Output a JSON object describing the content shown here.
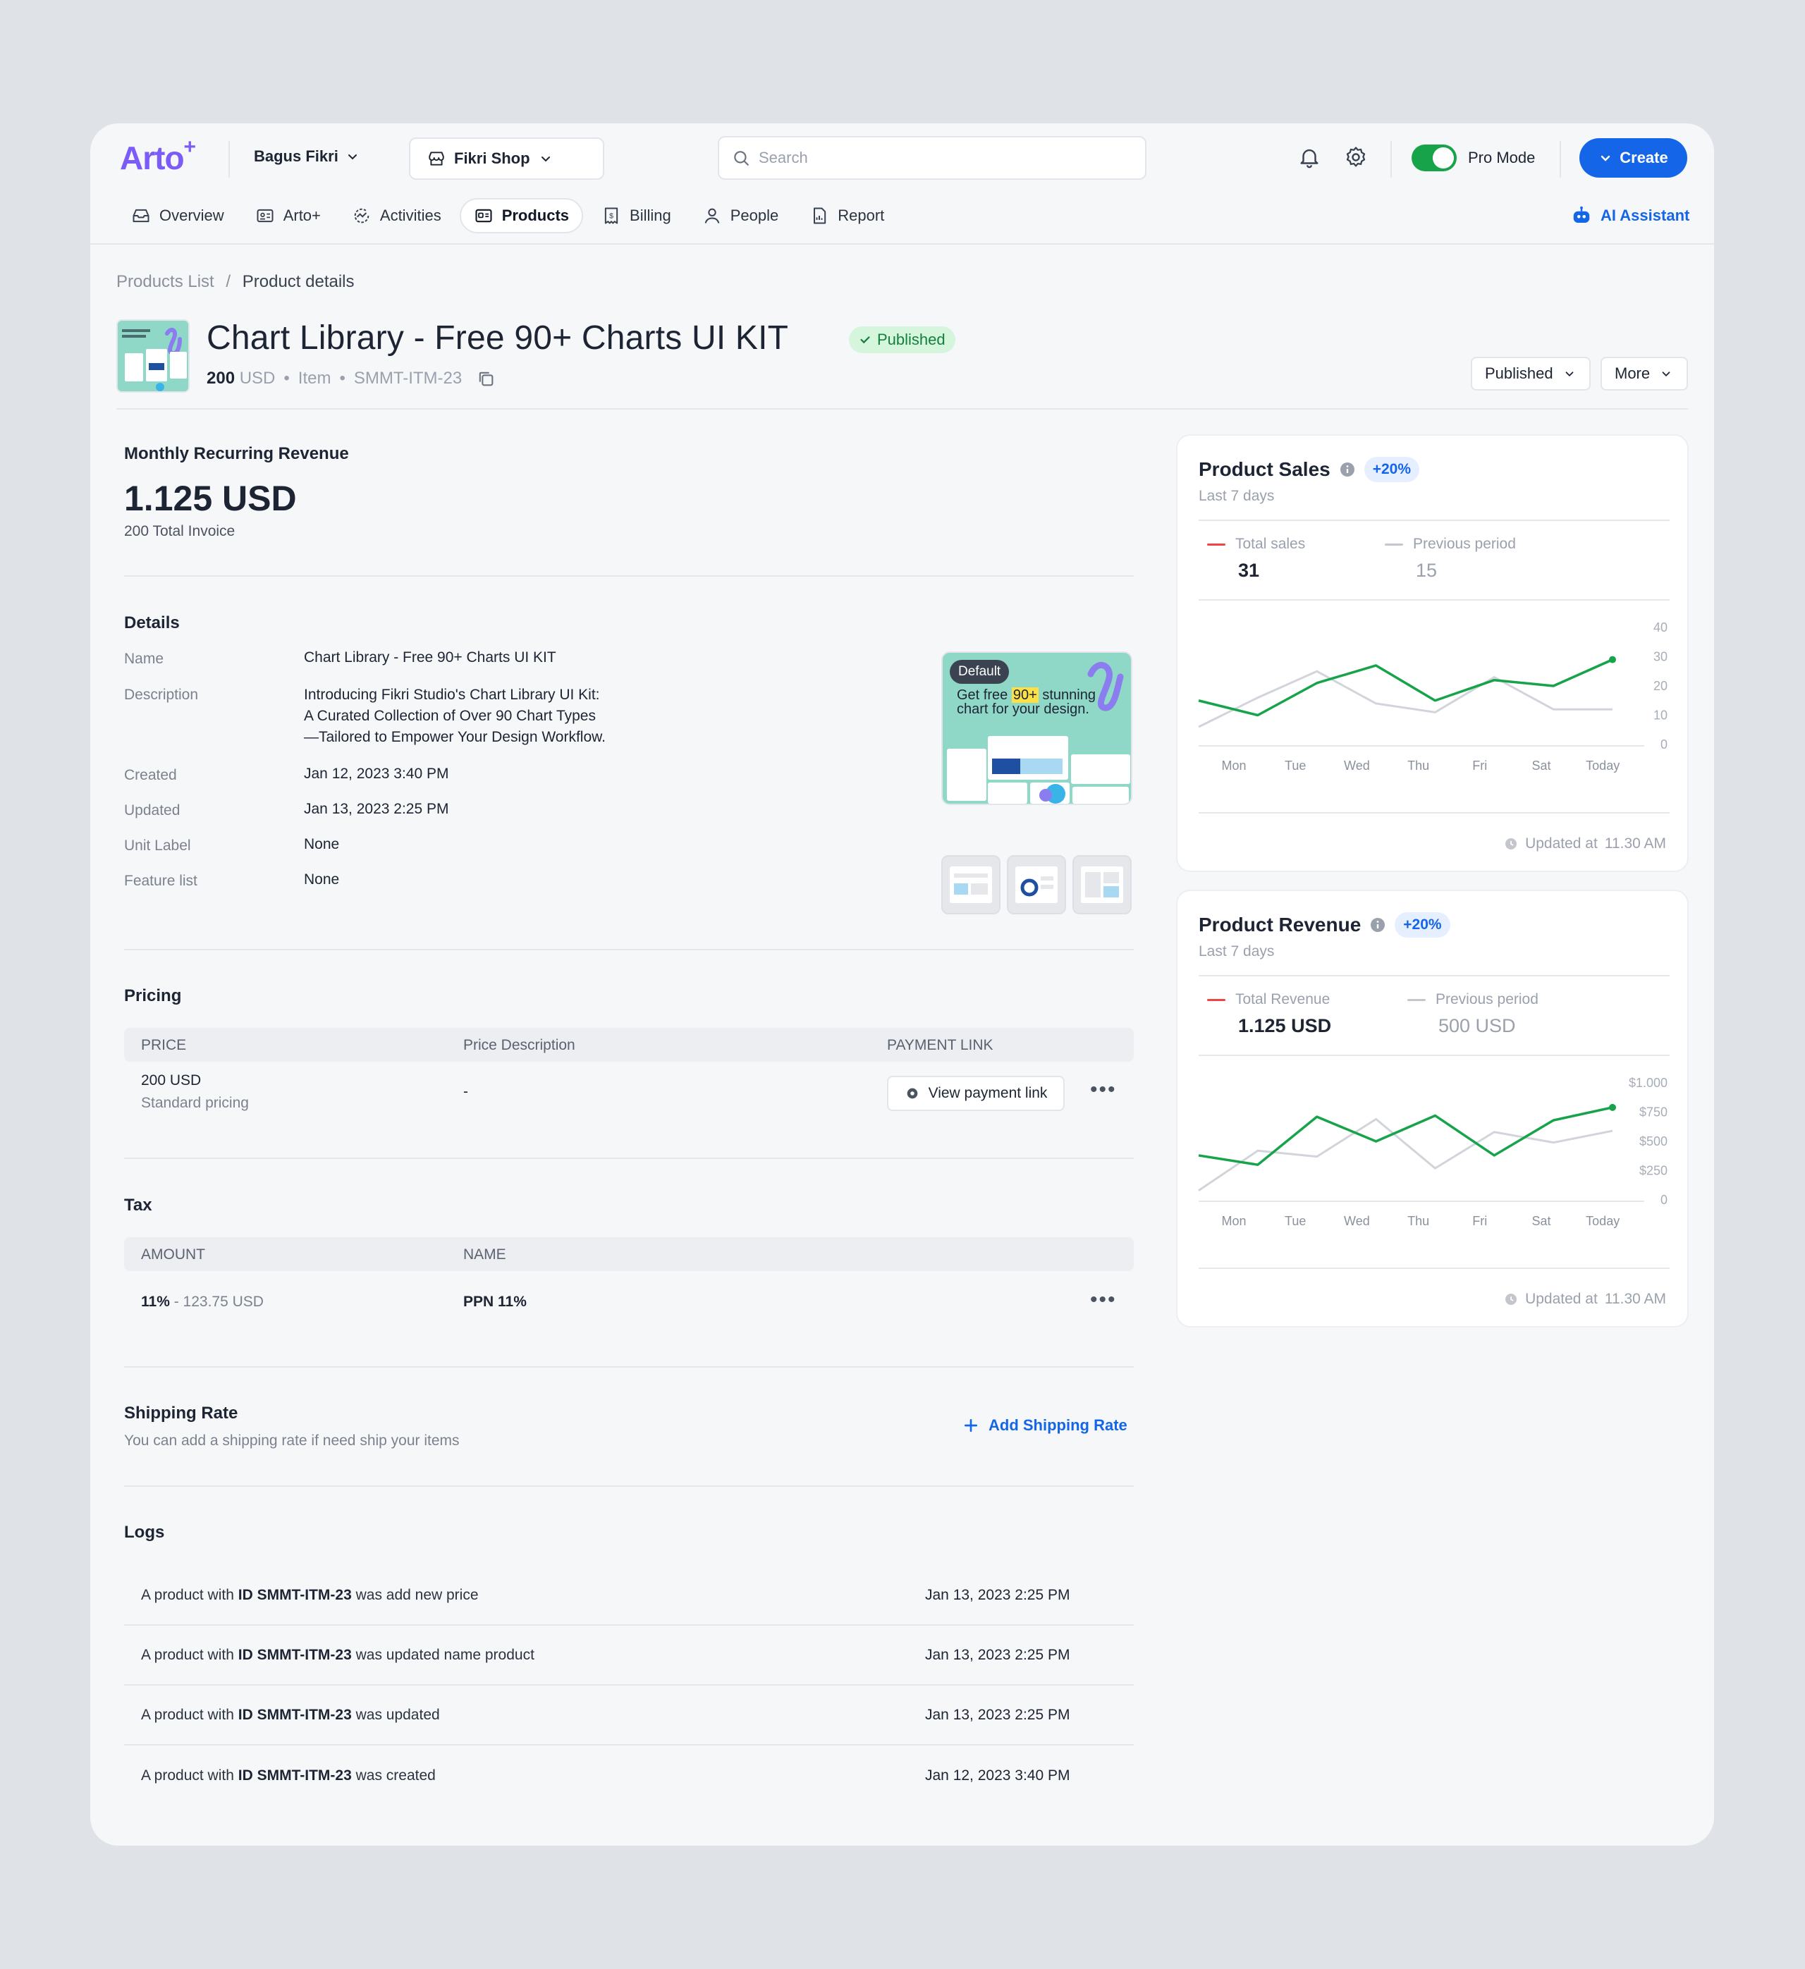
{
  "header": {
    "logo": "Arto",
    "logo_sup": "+",
    "user_name": "Bagus Fikri",
    "shop_name": "Fikri Shop",
    "search_placeholder": "Search",
    "pro_mode_label": "Pro Mode",
    "create_label": "Create"
  },
  "nav": {
    "items": [
      {
        "label": "Overview",
        "icon": "inbox-icon"
      },
      {
        "label": "Arto+",
        "icon": "id-card-icon"
      },
      {
        "label": "Activities",
        "icon": "activity-icon"
      },
      {
        "label": "Products",
        "icon": "product-icon",
        "active": true
      },
      {
        "label": "Billing",
        "icon": "receipt-icon"
      },
      {
        "label": "People",
        "icon": "user-icon"
      },
      {
        "label": "Report",
        "icon": "report-icon"
      }
    ],
    "ai_assistant_label": "AI Assistant"
  },
  "breadcrumb": {
    "parent": "Products List",
    "separator": "/",
    "current": "Product details"
  },
  "product": {
    "title": "Chart Library - Free 90+ Charts UI KIT",
    "status": "Published",
    "price": "200",
    "currency": "USD",
    "type": "Item",
    "sku": "SMMT-ITM-23",
    "status_dropdown_label": "Published",
    "more_label": "More"
  },
  "mrr": {
    "title": "Monthly Recurring Revenue",
    "value": "1.125 USD",
    "sub": "200 Total Invoice"
  },
  "details": {
    "title": "Details",
    "rows": [
      {
        "label": "Name",
        "value": "Chart Library - Free 90+ Charts UI KIT"
      },
      {
        "label": "Description",
        "value": "Introducing Fikri Studio's Chart Library UI Kit:\nA Curated Collection of Over 90 Chart Types\n—Tailored to Empower Your Design Workflow."
      },
      {
        "label": "Created",
        "value": "Jan 12, 2023 3:40 PM"
      },
      {
        "label": "Updated",
        "value": "Jan 13, 2023 2:25 PM"
      },
      {
        "label": "Unit Label",
        "value": "None"
      },
      {
        "label": "Feature list",
        "value": "None"
      }
    ],
    "preview_badge": "Default",
    "preview_headline_a": "Get free",
    "preview_headline_hl": "90+",
    "preview_headline_b": "stunning",
    "preview_headline_c": "chart for your design."
  },
  "pricing": {
    "title": "Pricing",
    "headers": [
      "PRICE",
      "Price Description",
      "PAYMENT LINK"
    ],
    "row": {
      "price": "200 USD",
      "price_sub": "Standard pricing",
      "description": "-",
      "link_label": "View payment link"
    }
  },
  "tax": {
    "title": "Tax",
    "headers": [
      "AMOUNT",
      "NAME"
    ],
    "row": {
      "amount": "11%",
      "amount_sub": "- 123.75 USD",
      "name": "PPN 11%"
    }
  },
  "shipping": {
    "title": "Shipping Rate",
    "sub": "You can add a shipping rate if need ship your items",
    "add_label": "Add Shipping Rate"
  },
  "logs": {
    "title": "Logs",
    "items": [
      {
        "pre": "A product with",
        "id": "ID SMMT-ITM-23",
        "post": "was add new price",
        "date": "Jan 13, 2023 2:25 PM"
      },
      {
        "pre": "A product with",
        "id": "ID SMMT-ITM-23",
        "post": "was updated name product",
        "date": "Jan 13, 2023 2:25 PM"
      },
      {
        "pre": "A product with",
        "id": "ID SMMT-ITM-23",
        "post": "was updated",
        "date": "Jan 13, 2023 2:25 PM"
      },
      {
        "pre": "A product with",
        "id": "ID SMMT-ITM-23",
        "post": "was created",
        "date": "Jan 12, 2023 3:40 PM"
      }
    ]
  },
  "sales_panel": {
    "title": "Product Sales",
    "change": "+20%",
    "period": "Last 7 days",
    "current_label": "Total sales",
    "current_value": "31",
    "previous_label": "Previous period",
    "previous_value": "15",
    "updated_label": "Updated at",
    "updated_time": "11.30 AM"
  },
  "revenue_panel": {
    "title": "Product Revenue",
    "change": "+20%",
    "period": "Last 7 days",
    "current_label": "Total Revenue",
    "current_value": "1.125 USD",
    "previous_label": "Previous period",
    "previous_value": "500 USD",
    "updated_label": "Updated at",
    "updated_time": "11.30 AM"
  },
  "colors": {
    "accent": "#1565e8",
    "brand": "#7b5cf6",
    "current_series": "#16a34a",
    "previous_series": "#d1d5db",
    "marker_current": "#ef4444"
  },
  "chart_data": [
    {
      "type": "line",
      "categories": [
        "Mon",
        "Tue",
        "Wed",
        "Thu",
        "Fri",
        "Sat",
        "Today"
      ],
      "ylim": [
        0,
        40
      ],
      "yticks": [
        "40",
        "30",
        "20",
        "10",
        "0"
      ],
      "series": [
        {
          "name": "Total sales",
          "values": [
            15,
            10,
            21,
            27,
            15,
            22,
            20,
            29
          ]
        },
        {
          "name": "Previous period",
          "values": [
            6,
            16,
            25,
            14,
            11,
            23,
            12,
            12
          ]
        }
      ],
      "grid": false
    },
    {
      "type": "line",
      "categories": [
        "Mon",
        "Tue",
        "Wed",
        "Thu",
        "Fri",
        "Sat",
        "Today"
      ],
      "ylim": [
        0,
        1000
      ],
      "yticks": [
        "$1.000",
        "$750",
        "$500",
        "$250",
        "0"
      ],
      "series": [
        {
          "name": "Total Revenue",
          "values": [
            380,
            300,
            710,
            500,
            720,
            380,
            680,
            790
          ]
        },
        {
          "name": "Previous period",
          "values": [
            80,
            420,
            370,
            690,
            270,
            580,
            490,
            590
          ]
        }
      ],
      "grid": false
    }
  ]
}
